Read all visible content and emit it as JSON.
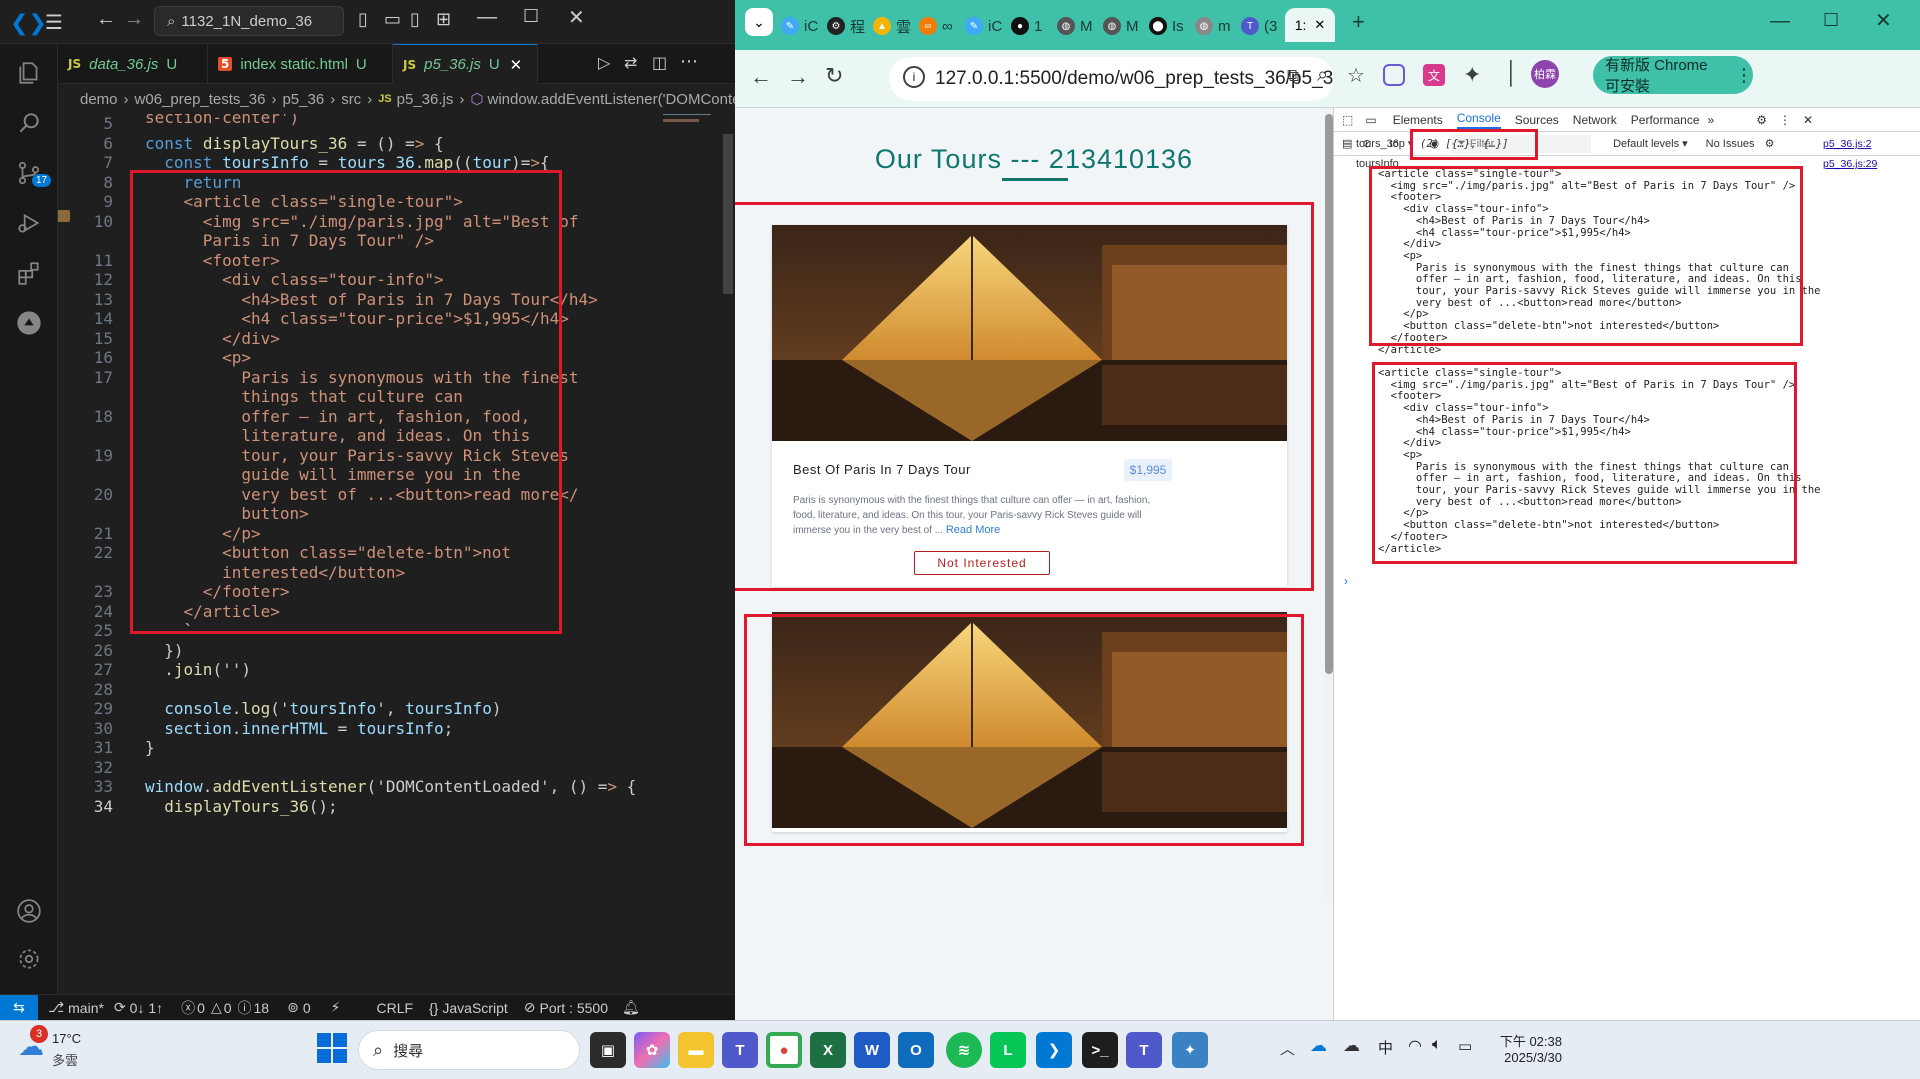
{
  "vscode": {
    "search_text": "1132_1N_demo_36",
    "tabs": [
      {
        "name": "data_36.js",
        "status": "U",
        "icon": "JS"
      },
      {
        "name": "index static.html",
        "status": "U",
        "icon": "5"
      },
      {
        "name": "p5_36.js",
        "status": "U",
        "icon": "JS"
      }
    ],
    "breadcrumb": [
      "demo",
      "w06_prep_tests_36",
      "p5_36",
      "src",
      "p5_36.js",
      "window.addEventListener('DOMContentLoaded'..."
    ],
    "scroll_top_text": "section-center')",
    "source_control_badge": "17",
    "line_numbers": [
      "5",
      "6",
      "7",
      "8",
      "9",
      "10",
      "",
      "11",
      "12",
      "13",
      "14",
      "15",
      "16",
      "17",
      "",
      "18",
      "",
      "19",
      "",
      "20",
      "",
      "21",
      "22",
      "",
      "23",
      "24",
      "25",
      "26",
      "27",
      "28",
      "29",
      "30",
      "31",
      "32",
      "33",
      "34"
    ],
    "code_lines": [
      "",
      "const displayTours_36 = () => {",
      "  const toursInfo = tours_36.map((tour)=>{",
      "    return",
      "    <article class=\"single-tour\">",
      "      <img src=\"./img/paris.jpg\" alt=\"Best of",
      "      Paris in 7 Days Tour\" />",
      "      <footer>",
      "        <div class=\"tour-info\">",
      "          <h4>Best of Paris in 7 Days Tour</h4>",
      "          <h4 class=\"tour-price\">$1,995</h4>",
      "        </div>",
      "        <p>",
      "          Paris is synonymous with the finest",
      "          things that culture can",
      "          offer — in art, fashion, food,",
      "          literature, and ideas. On this",
      "          tour, your Paris-savvy Rick Steves",
      "          guide will immerse you in the",
      "          very best of ...<button>read more</",
      "          button>",
      "        </p>",
      "        <button class=\"delete-btn\">not",
      "        interested</button>",
      "      </footer>",
      "    </article>",
      "    `",
      "  })",
      "  .join('')",
      "",
      "  console.log('toursInfo', toursInfo)",
      "  section.innerHTML = toursInfo;",
      "}",
      "",
      "window.addEventListener('DOMContentLoaded', () => {",
      "  displayTours_36();"
    ],
    "status": {
      "branch": "main*",
      "sync": "0↓ 1↑",
      "errors": "0",
      "warnings": "0",
      "infos": "18",
      "ports": "0",
      "eol": "CRLF",
      "language": "JavaScript",
      "port": "Port : 5500"
    }
  },
  "chrome": {
    "tabs": [
      "iC",
      "程",
      "雲",
      "∞",
      "iC",
      "1",
      "M",
      "M",
      "Is",
      "m",
      "(3",
      "1:"
    ],
    "url": "127.0.0.1:5500/demo/w06_prep_tests_36/p5_36/s...",
    "update_button": "有新版 Chrome 可安裝",
    "profile": "柏霖"
  },
  "webpage": {
    "title": "Our Tours --- 213410136",
    "tours": [
      {
        "name": "Best Of Paris In 7 Days Tour",
        "price": "$1,995",
        "info": "Paris is synonymous with the finest things that culture can offer — in art, fashion, food, literature, and ideas. On this tour, your Paris-savvy Rick Steves guide will immerse you in the very best of ...",
        "read_more": "Read More",
        "button": "Not Interested"
      }
    ]
  },
  "devtools": {
    "panels": [
      "Elements",
      "Console",
      "Sources",
      "Network",
      "Performance"
    ],
    "active_panel": "Console",
    "context": "top",
    "filter_placeholder": "Filter",
    "levels": "Default levels",
    "issues": "No Issues",
    "log1_label": "tours_36",
    "log1_value": "(2) [{…}, {…}]",
    "log1_source": "p5_36.js:2",
    "log2_label": "toursInfo",
    "log2_source": "p5_36.js:29",
    "article_lines": [
      "<article class=\"single-tour\">",
      "  <img src=\"./img/paris.jpg\" alt=\"Best of Paris in 7 Days Tour\" />",
      "  <footer>",
      "    <div class=\"tour-info\">",
      "      <h4>Best of Paris in 7 Days Tour</h4>",
      "      <h4 class=\"tour-price\">$1,995</h4>",
      "    </div>",
      "    <p>",
      "      Paris is synonymous with the finest things that culture can",
      "      offer — in art, fashion, food, literature, and ideas. On this",
      "      tour, your Paris-savvy Rick Steves guide will immerse you in the",
      "      very best of ...<button>read more</button>",
      "    </p>",
      "    <button class=\"delete-btn\">not interested</button>",
      "  </footer>",
      "</article>"
    ]
  },
  "taskbar": {
    "weather_badge": "3",
    "temperature": "17°C",
    "weather": "多雲",
    "search": "搜尋",
    "ime": "中",
    "time": "下午 02:38",
    "date": "2025/3/30"
  }
}
